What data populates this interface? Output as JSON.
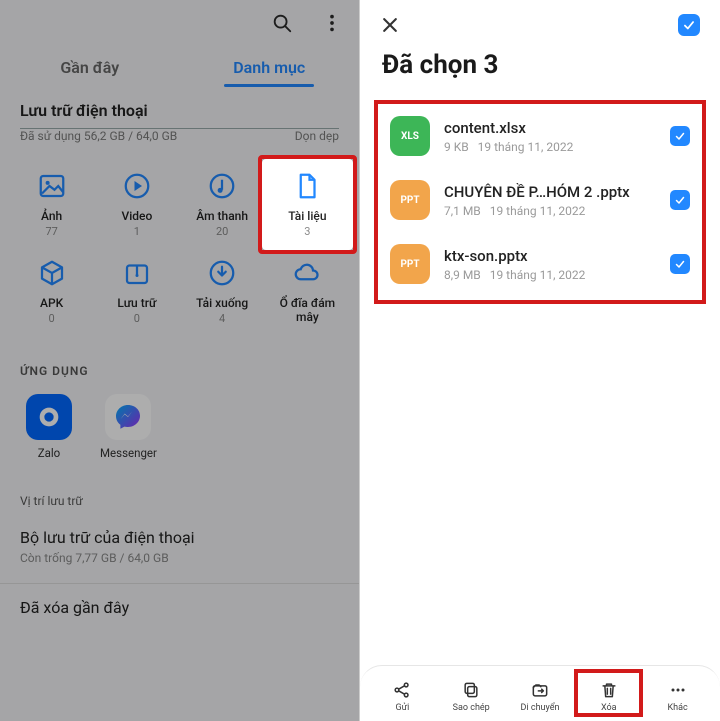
{
  "left": {
    "tabs": {
      "recent": "Gần đây",
      "categories": "Danh mục"
    },
    "storage": {
      "title": "Lưu trữ điện thoại",
      "used_line": "Đã sử dụng 56,2 GB / 64,0 GB",
      "cleanup": "Dọn dẹp"
    },
    "tiles": [
      {
        "name": "Ảnh",
        "count": "77",
        "icon": "image"
      },
      {
        "name": "Video",
        "count": "1",
        "icon": "video"
      },
      {
        "name": "Âm thanh",
        "count": "20",
        "icon": "audio"
      },
      {
        "name": "Tài liệu",
        "count": "3",
        "icon": "doc",
        "highlight": true
      },
      {
        "name": "APK",
        "count": "0",
        "icon": "apk"
      },
      {
        "name": "Lưu trữ",
        "count": "0",
        "icon": "archive"
      },
      {
        "name": "Tải xuống",
        "count": "4",
        "icon": "download"
      },
      {
        "name": "Ổ đĩa đám mây",
        "count": "",
        "icon": "cloud"
      }
    ],
    "apps_label": "ỨNG DỤNG",
    "apps": [
      {
        "name": "Zalo",
        "kind": "zalo"
      },
      {
        "name": "Messenger",
        "kind": "msgr"
      }
    ],
    "loc_label": "Vị trí lưu trữ",
    "loc_item": {
      "title": "Bộ lưu trữ của điện thoại",
      "sub": "Còn trống 7,77 GB / 64,0 GB"
    },
    "recent_deleted": "Đã xóa gần đây"
  },
  "right": {
    "title": "Đã chọn 3",
    "files": [
      {
        "name": "content.xlsx",
        "size": "9 KB",
        "date": "19 tháng 11, 2022",
        "type": "XLS",
        "cls": "xls"
      },
      {
        "name": "CHUYÊN ĐỀ P…HÓM 2 .pptx",
        "size": "7,1 MB",
        "date": "19 tháng 11, 2022",
        "type": "PPT",
        "cls": "ppt"
      },
      {
        "name": "ktx-son.pptx",
        "size": "8,9 MB",
        "date": "19 tháng 11, 2022",
        "type": "PPT",
        "cls": "ppt"
      }
    ],
    "bottom": [
      {
        "label": "Gửi",
        "icon": "share"
      },
      {
        "label": "Sao chép",
        "icon": "copy"
      },
      {
        "label": "Di chuyển",
        "icon": "move"
      },
      {
        "label": "Xóa",
        "icon": "trash",
        "highlight": true
      },
      {
        "label": "Khác",
        "icon": "more"
      }
    ]
  }
}
